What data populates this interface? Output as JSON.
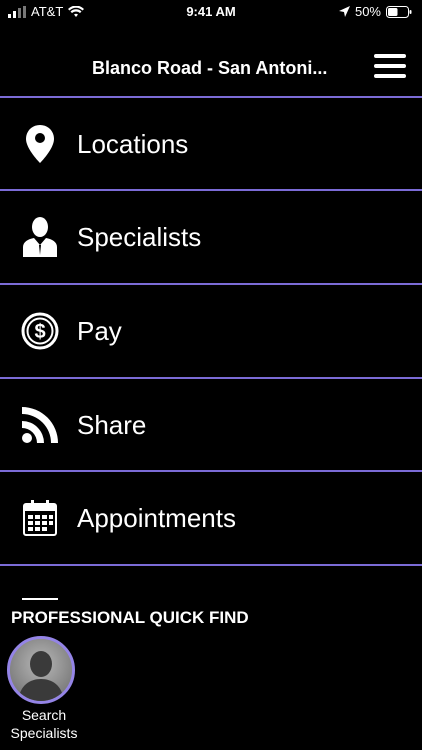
{
  "status_bar": {
    "carrier": "AT&T",
    "time": "9:41 AM",
    "battery": "50%",
    "battery_level": 0.5
  },
  "header": {
    "title": "Blanco Road - San Antoni..."
  },
  "menu": {
    "items": [
      {
        "label": "Locations",
        "icon": "location-pin-icon"
      },
      {
        "label": "Specialists",
        "icon": "person-icon"
      },
      {
        "label": "Pay",
        "icon": "dollar-icon"
      },
      {
        "label": "Share",
        "icon": "rss-icon"
      },
      {
        "label": "Appointments",
        "icon": "calendar-icon"
      }
    ]
  },
  "quick_find": {
    "title": "PROFESSIONAL QUICK FIND",
    "search_label": "Search Specialists"
  },
  "colors": {
    "background": "#000000",
    "divider": "#7b6bd6",
    "avatar_ring": "#9484e6"
  }
}
